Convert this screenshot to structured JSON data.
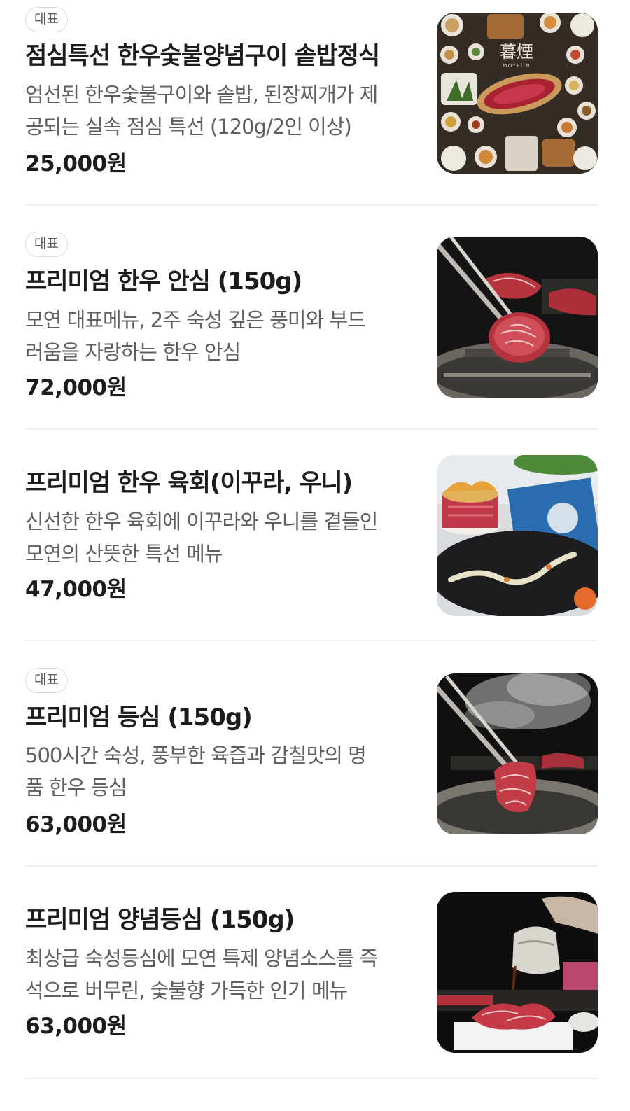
{
  "menu": {
    "items": [
      {
        "badge": "대표",
        "title": "점심특선 한우숯불양념구이 솥밥정식",
        "desc_line1": "엄선된 한우숯불구이와 솥밥, 된장찌개가 제",
        "desc_line2": "공되는 실속 점심 특선 (120g/2인 이상)",
        "price": "25,000원",
        "image_sign": "暮煙",
        "image_sign_sub": "MOYEON"
      },
      {
        "badge": "대표",
        "title": "프리미엄 한우 안심 (150g)",
        "desc_line1": "모연 대표메뉴, 2주 숙성 깊은 풍미와 부드",
        "desc_line2": "러움을 자랑하는 한우 안심",
        "price": "72,000원"
      },
      {
        "title": "프리미엄 한우 육회(이꾸라, 우니)",
        "desc_line1": "신선한 한우 육회에 이꾸라와 우니를 곁들인",
        "desc_line2": "모연의 산뜻한 특선 메뉴",
        "price": "47,000원"
      },
      {
        "badge": "대표",
        "title": "프리미엄 등심 (150g)",
        "desc_line1": "500시간 숙성, 풍부한 육즙과 감칠맛의 명",
        "desc_line2": "품 한우 등심",
        "price": "63,000원"
      },
      {
        "title": "프리미엄 양념등심 (150g)",
        "desc_line1": "최상급 숙성등심에 모연 특제 양념소스를 즉",
        "desc_line2": "석으로 버무린, 숯불향 가득한 인기 메뉴",
        "price": "63,000원"
      }
    ]
  },
  "colors": {
    "text_primary": "#1c1c1c",
    "text_secondary": "#5f5f5f",
    "badge_border": "#dcdcdc",
    "divider": "#efefef"
  }
}
